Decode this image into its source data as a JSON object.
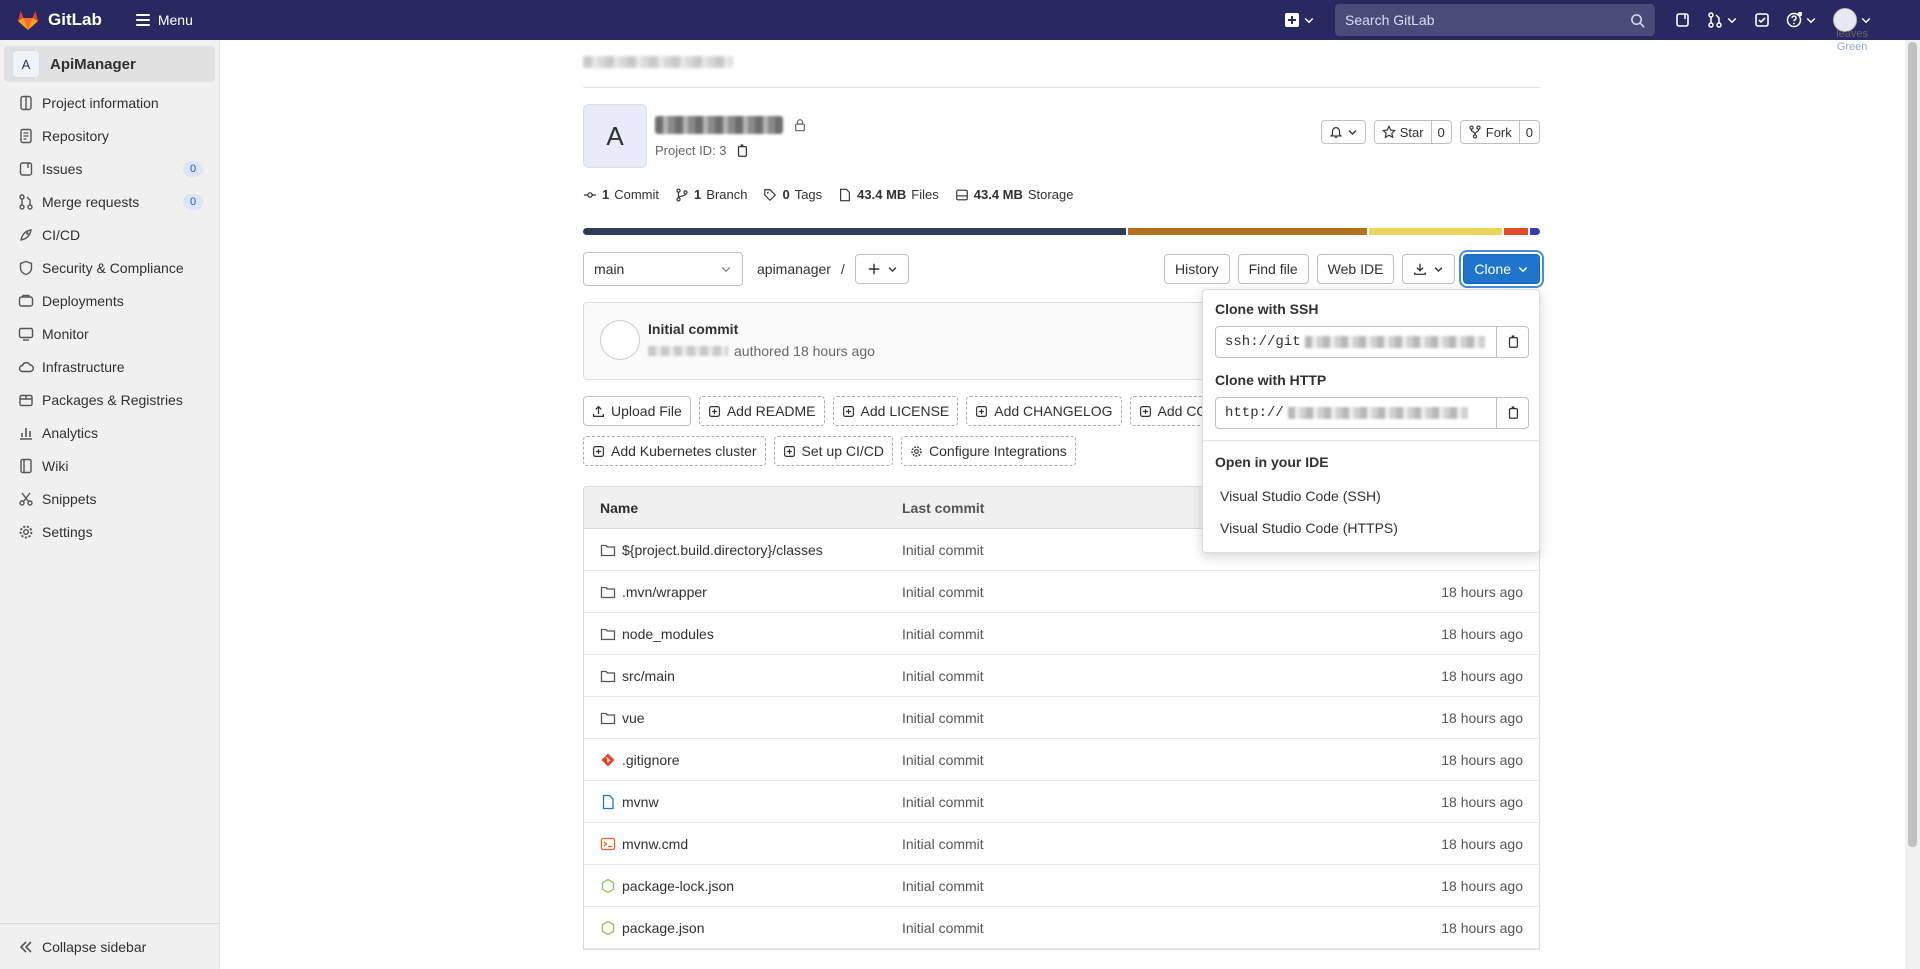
{
  "topbar": {
    "brand": "GitLab",
    "menu_label": "Menu",
    "search_placeholder": "Search GitLab",
    "user_label_1": "leaves",
    "user_label_2": "Green"
  },
  "sidebar": {
    "project_initial": "A",
    "project_name": "ApiManager",
    "items": [
      {
        "label": "Project information",
        "icon": "info-icon"
      },
      {
        "label": "Repository",
        "icon": "document-icon"
      },
      {
        "label": "Issues",
        "icon": "issues-icon",
        "badge": "0"
      },
      {
        "label": "Merge requests",
        "icon": "merge-request-icon",
        "badge": "0"
      },
      {
        "label": "CI/CD",
        "icon": "rocket-icon"
      },
      {
        "label": "Security & Compliance",
        "icon": "shield-icon"
      },
      {
        "label": "Deployments",
        "icon": "deployments-icon"
      },
      {
        "label": "Monitor",
        "icon": "monitor-icon"
      },
      {
        "label": "Infrastructure",
        "icon": "cloud-icon"
      },
      {
        "label": "Packages & Registries",
        "icon": "package-icon"
      },
      {
        "label": "Analytics",
        "icon": "chart-icon"
      },
      {
        "label": "Wiki",
        "icon": "book-icon"
      },
      {
        "label": "Snippets",
        "icon": "scissors-icon"
      },
      {
        "label": "Settings",
        "icon": "gear-icon"
      }
    ],
    "collapse_label": "Collapse sidebar"
  },
  "project": {
    "initial": "A",
    "id_text": "Project ID: 3",
    "star_label": "Star",
    "star_count": "0",
    "fork_label": "Fork",
    "fork_count": "0",
    "stats": {
      "commits_num": "1",
      "commits_label": "Commit",
      "branches_num": "1",
      "branches_label": "Branch",
      "tags_num": "0",
      "tags_label": "Tags",
      "files_num": "43.4 MB",
      "files_label": "Files",
      "storage_num": "43.4 MB",
      "storage_label": "Storage"
    },
    "languages": [
      {
        "color": "#2f3d54",
        "share": 0.572
      },
      {
        "color": "#b3701f",
        "share": 0.252
      },
      {
        "color": "#ebd65a",
        "share": 0.14
      },
      {
        "color": "#e24b2a",
        "share": 0.025
      },
      {
        "color": "#3b3bb0",
        "share": 0.011
      }
    ]
  },
  "repo_bar": {
    "branch": "main",
    "path": "apimanager",
    "path_sep": "/",
    "history": "History",
    "find_file": "Find file",
    "web_ide": "Web IDE",
    "clone": "Clone"
  },
  "last_commit": {
    "title": "Initial commit",
    "meta": "authored 18 hours ago"
  },
  "actions_row1": [
    "Upload File",
    "Add README",
    "Add LICENSE",
    "Add CHANGELOG",
    "Add CON"
  ],
  "actions_row2": [
    "Add Kubernetes cluster",
    "Set up CI/CD",
    "Configure Integrations"
  ],
  "table": {
    "col_name": "Name",
    "col_commit": "Last commit",
    "rows": [
      {
        "name": "${project.build.directory}/classes",
        "icon": "folder-icon",
        "commit": "Initial commit",
        "time": ""
      },
      {
        "name": ".mvn/wrapper",
        "icon": "folder-icon",
        "commit": "Initial commit",
        "time": "18 hours ago"
      },
      {
        "name": "node_modules",
        "icon": "folder-icon",
        "commit": "Initial commit",
        "time": "18 hours ago"
      },
      {
        "name": "src/main",
        "icon": "folder-icon",
        "commit": "Initial commit",
        "time": "18 hours ago"
      },
      {
        "name": "vue",
        "icon": "folder-icon",
        "commit": "Initial commit",
        "time": "18 hours ago"
      },
      {
        "name": ".gitignore",
        "icon": "git-icon",
        "commit": "Initial commit",
        "time": "18 hours ago"
      },
      {
        "name": "mvnw",
        "icon": "file-icon",
        "commit": "Initial commit",
        "time": "18 hours ago"
      },
      {
        "name": "mvnw.cmd",
        "icon": "terminal-icon",
        "commit": "Initial commit",
        "time": "18 hours ago"
      },
      {
        "name": "package-lock.json",
        "icon": "nodejs-icon",
        "commit": "Initial commit",
        "time": "18 hours ago"
      },
      {
        "name": "package.json",
        "icon": "nodejs-icon",
        "commit": "Initial commit",
        "time": "18 hours ago"
      }
    ]
  },
  "clone_dropdown": {
    "ssh_label": "Clone with SSH",
    "ssh_prefix": "ssh://git",
    "http_label": "Clone with HTTP",
    "http_prefix": "http://",
    "ide_label": "Open in your IDE",
    "ide_ssh": "Visual Studio Code (SSH)",
    "ide_https": "Visual Studio Code (HTTPS)"
  }
}
